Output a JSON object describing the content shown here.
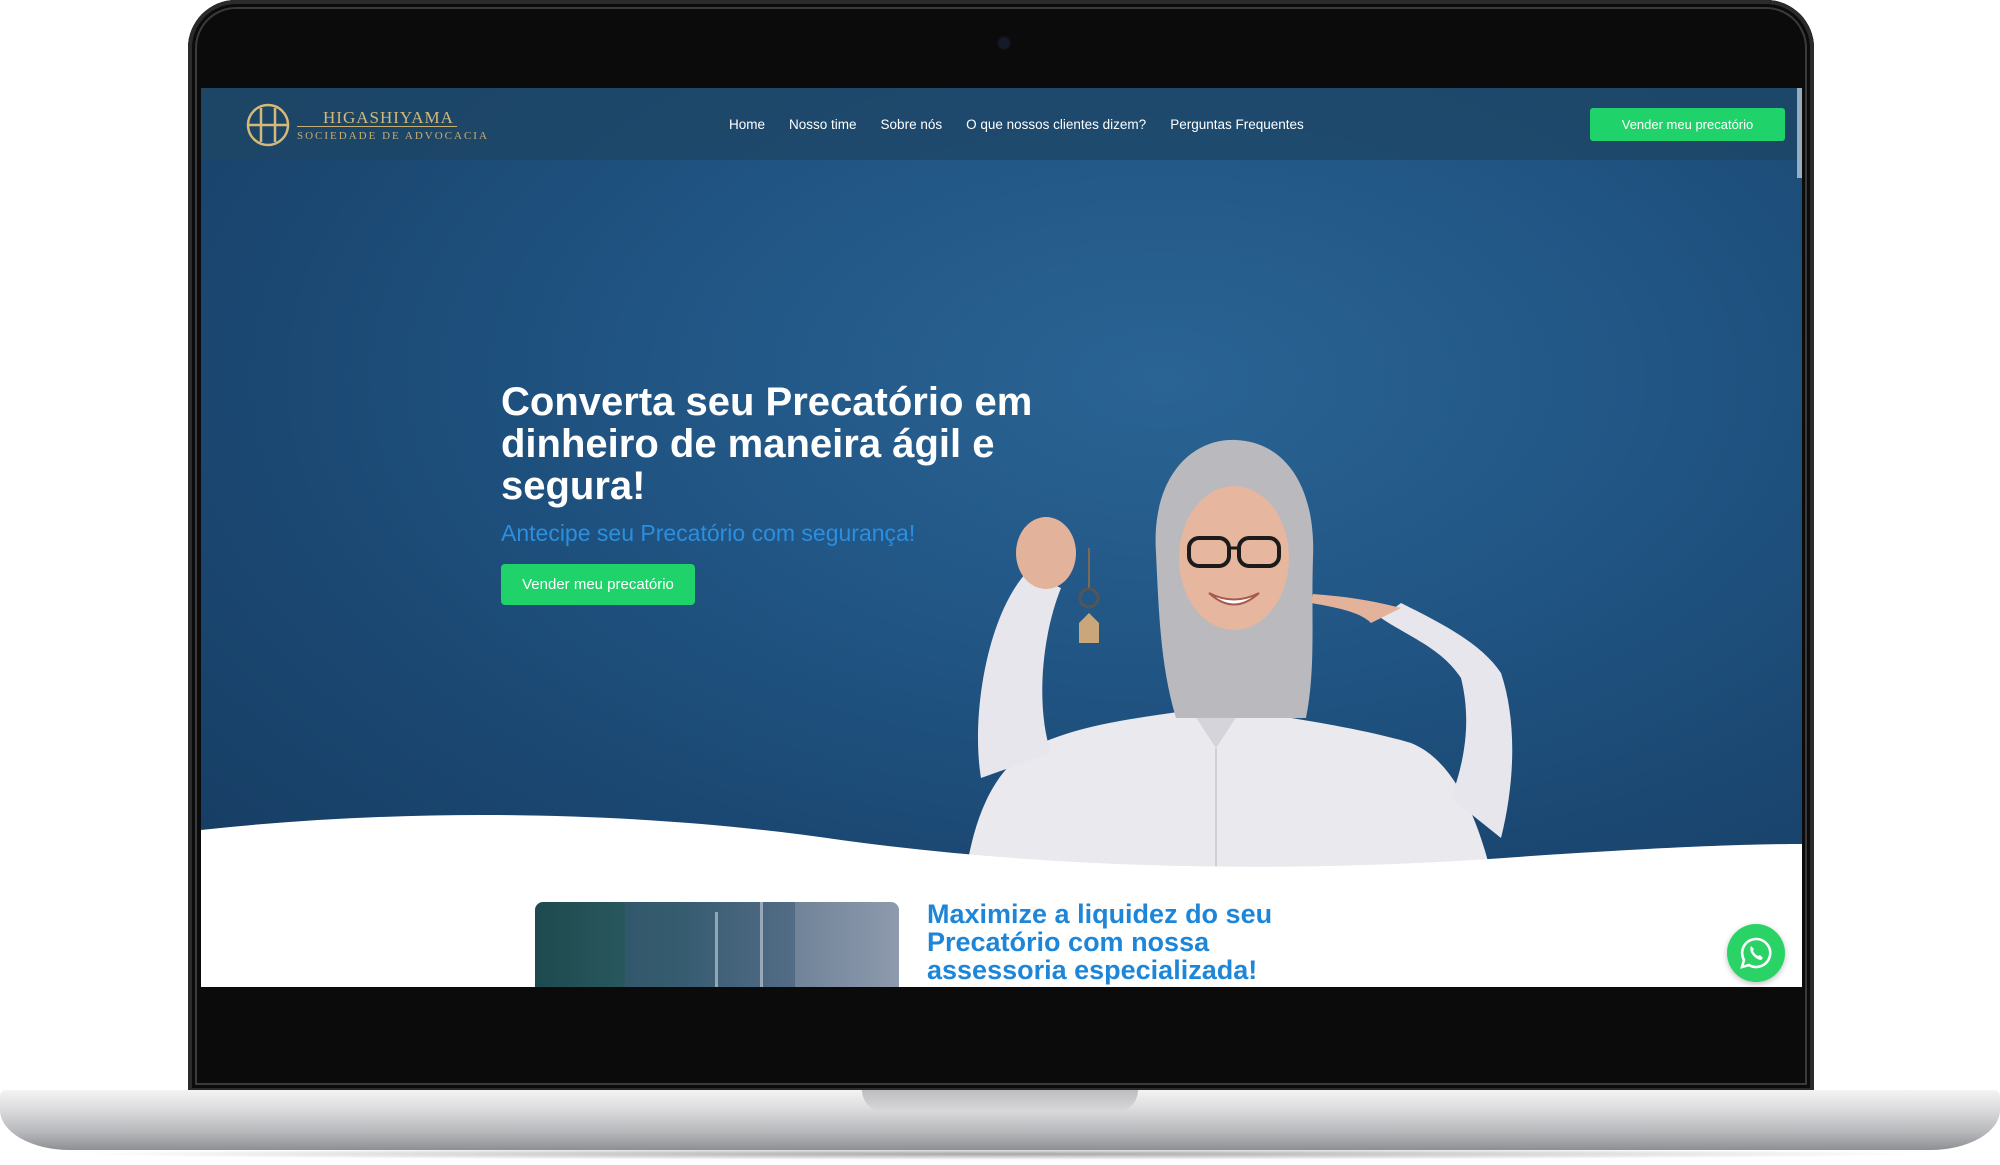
{
  "header": {
    "logo_name": "HIGASHIYAMA",
    "logo_subtitle": "SOCIEDADE DE ADVOCACIA",
    "nav": [
      "Home",
      "Nosso time",
      "Sobre nós",
      "O que nossos clientes dizem?",
      "Perguntas Frequentes"
    ],
    "cta_label": "Vender meu precatório"
  },
  "hero": {
    "title": "Converta seu Precatório em dinheiro de maneira ágil e segura!",
    "subtitle": "Antecipe seu Precatório com segurança!",
    "cta_label": "Vender meu precatório"
  },
  "section2": {
    "title": "Maximize a liquidez do seu Precatório com nossa assessoria especializada!"
  },
  "colors": {
    "hero_blue": "#1f5283",
    "cta_green": "#1fd26a",
    "accent_blue": "#1e86d8",
    "logo_gold": "#d4b979",
    "whatsapp_green": "#2ad366"
  },
  "icons": {
    "logo": "higashiyama-logo-mark",
    "floating": "whatsapp-icon"
  }
}
